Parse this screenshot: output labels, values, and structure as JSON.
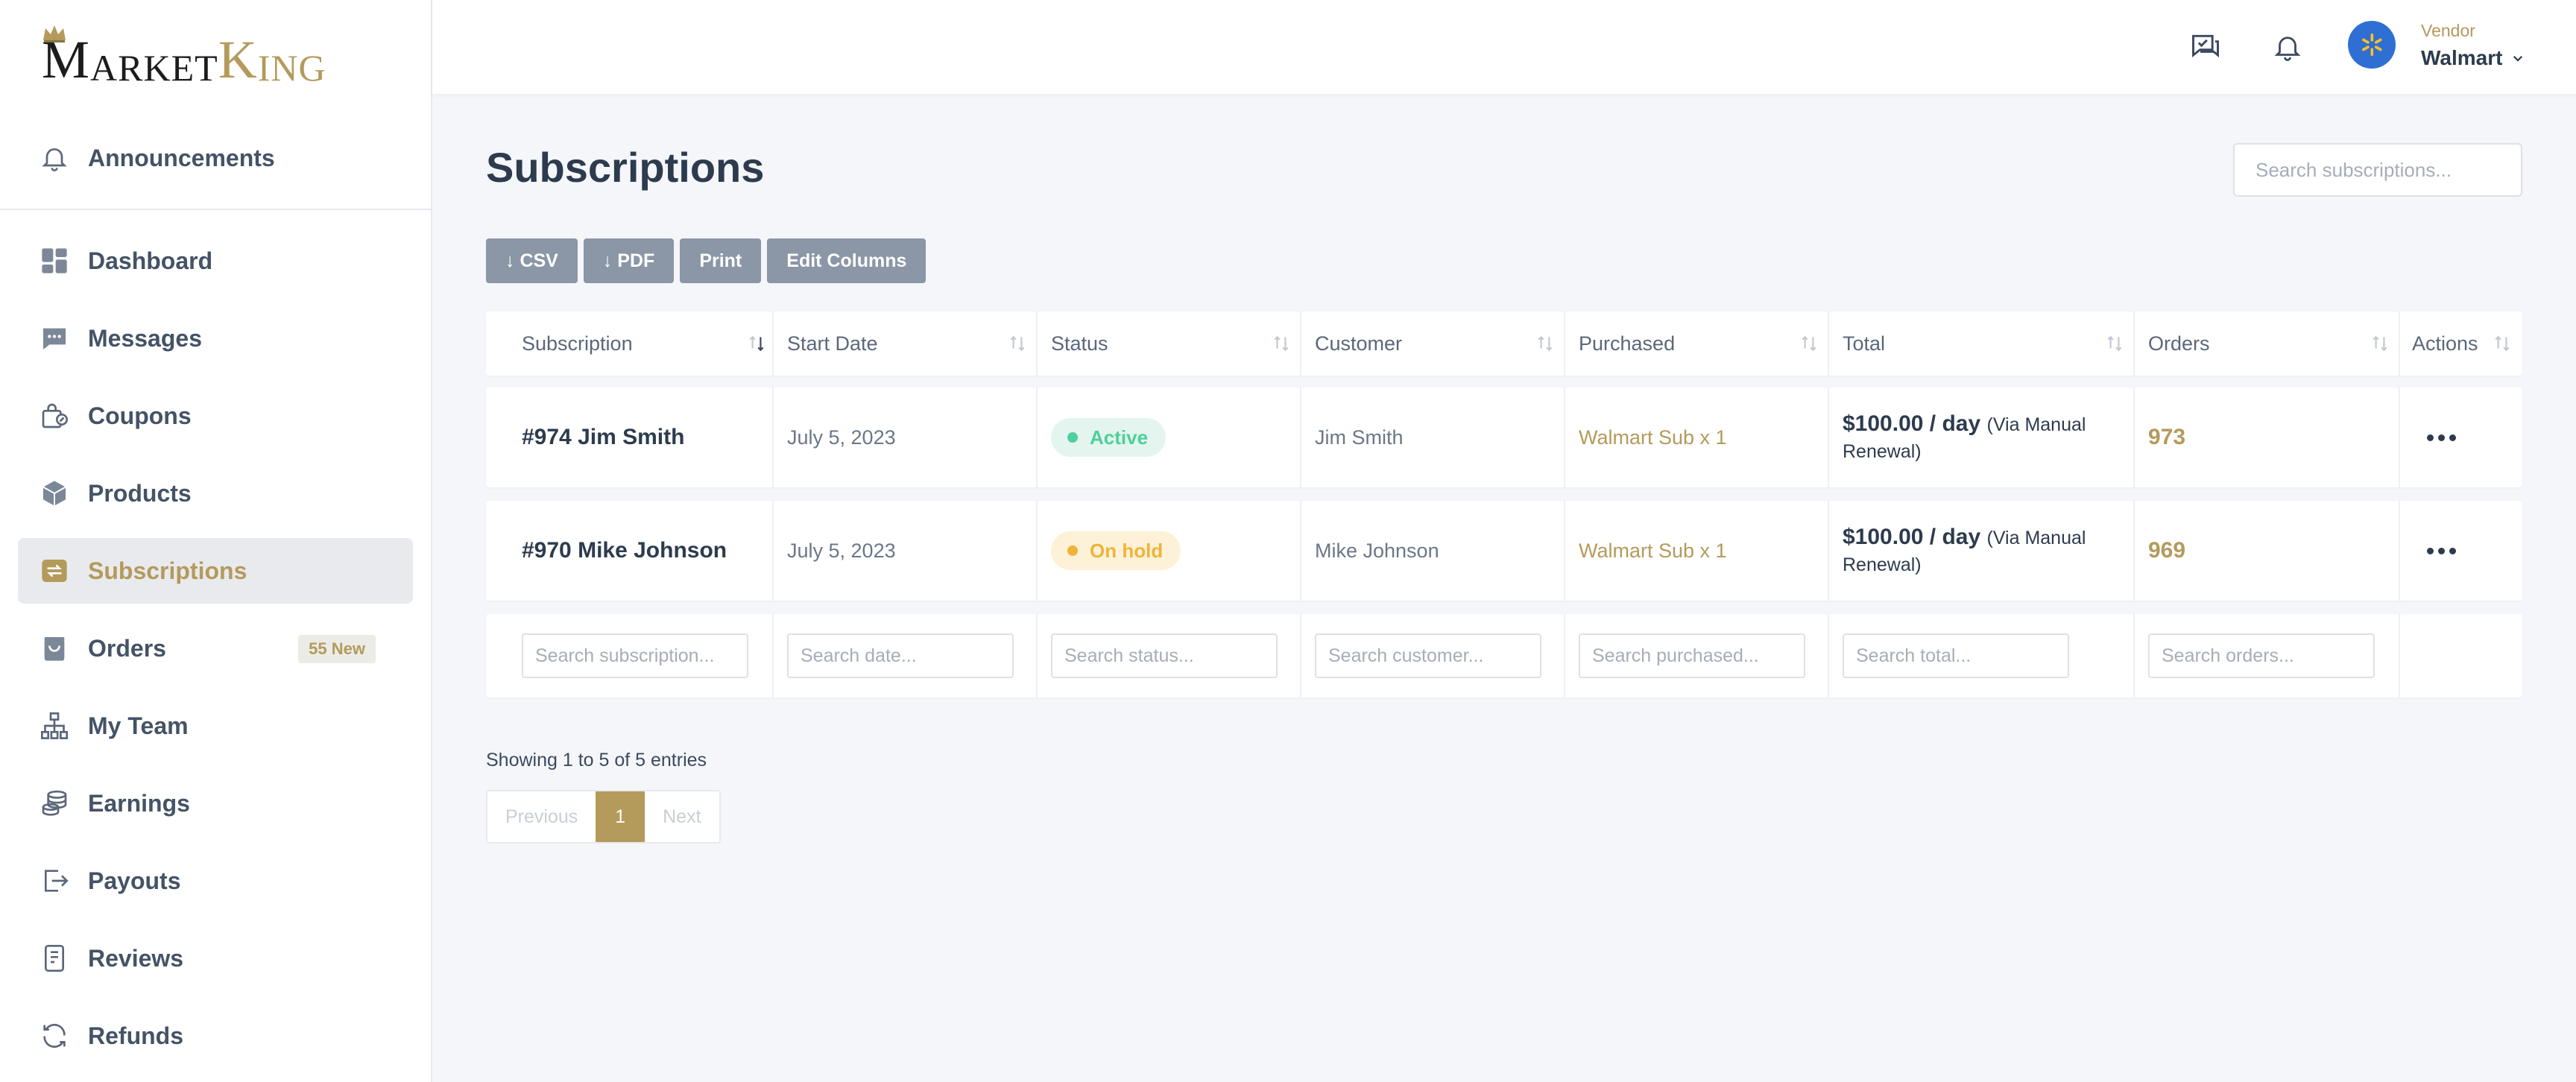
{
  "brand": {
    "first_initial": "M",
    "first_rest": "ARKET",
    "second_initial": "K",
    "second_rest": "ING"
  },
  "sidebar": {
    "items": [
      {
        "label": "Announcements",
        "icon": "bell-icon"
      },
      {
        "label": "Dashboard",
        "icon": "dashboard-grid-icon"
      },
      {
        "label": "Messages",
        "icon": "chat-bubble-icon"
      },
      {
        "label": "Coupons",
        "icon": "coupon-bag-icon"
      },
      {
        "label": "Products",
        "icon": "box-icon"
      },
      {
        "label": "Subscriptions",
        "icon": "repeat-icon",
        "active": true
      },
      {
        "label": "Orders",
        "icon": "shopping-bag-icon",
        "badge": "55 New"
      },
      {
        "label": "My Team",
        "icon": "org-chart-icon"
      },
      {
        "label": "Earnings",
        "icon": "coins-icon"
      },
      {
        "label": "Payouts",
        "icon": "payout-icon"
      },
      {
        "label": "Reviews",
        "icon": "review-doc-icon"
      },
      {
        "label": "Refunds",
        "icon": "refresh-icon"
      }
    ]
  },
  "header": {
    "vendor_role": "Vendor",
    "vendor_name": "Walmart"
  },
  "page": {
    "title": "Subscriptions",
    "search_placeholder": "Search subscriptions...",
    "toolbar": {
      "csv": "↓ CSV",
      "pdf": "↓ PDF",
      "print": "Print",
      "edit_columns": "Edit Columns"
    }
  },
  "table": {
    "columns": [
      "Subscription",
      "Start Date",
      "Status",
      "Customer",
      "Purchased",
      "Total",
      "Orders",
      "Actions"
    ],
    "rows": [
      {
        "subscription": "#974 Jim Smith",
        "start_date": "July 5, 2023",
        "status": "Active",
        "customer": "Jim Smith",
        "purchased": "Walmart Sub x 1",
        "total_main": "$100.00 / day",
        "total_note": "(Via Manual Renewal)",
        "orders": "973"
      },
      {
        "subscription": "#970 Mike Johnson",
        "start_date": "July 5, 2023",
        "status": "On hold",
        "customer": "Mike Johnson",
        "purchased": "Walmart Sub x 1",
        "total_main": "$100.00 / day",
        "total_note": "(Via Manual Renewal)",
        "orders": "969"
      }
    ],
    "filters": {
      "subscription": "Search subscription...",
      "date": "Search date...",
      "status": "Search status...",
      "customer": "Search customer...",
      "purchased": "Search purchased...",
      "total": "Search total...",
      "orders": "Search orders..."
    }
  },
  "footer": {
    "entries_text": "Showing 1 to 5 of 5 entries",
    "prev": "Previous",
    "current_page": "1",
    "next": "Next"
  },
  "colors": {
    "accent": "#b49a5b",
    "active_status": "#4fcf9c",
    "hold_status": "#f0b33a",
    "button": "#8b96a6"
  }
}
